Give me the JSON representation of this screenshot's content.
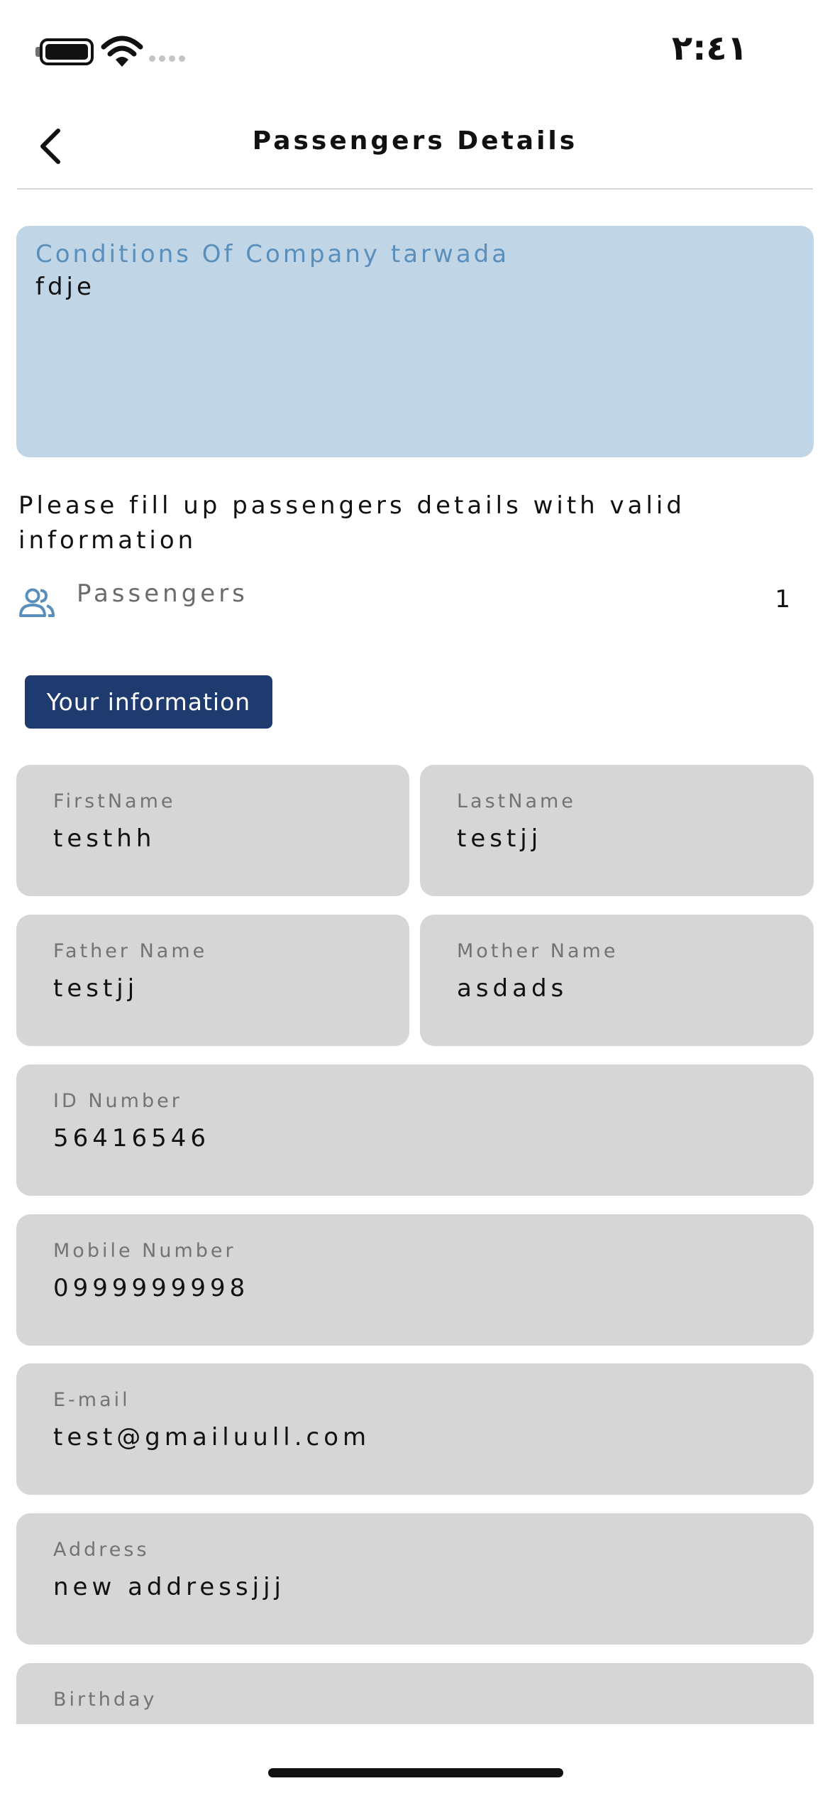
{
  "status_bar": {
    "time": "٢:٤١",
    "icons": [
      "battery-icon",
      "wifi-icon",
      "signal-icon"
    ]
  },
  "nav": {
    "title": "Passengers Details",
    "back_icon": "chevron-left-icon"
  },
  "conditions": {
    "title": "Conditions Of Company tarwada",
    "body": "fdje",
    "background": "#c0d6e7",
    "title_color": "#5a8fbc"
  },
  "instructions": "Please fill up passengers details with valid information",
  "passengers": {
    "icon": "people-icon",
    "label": "Passengers",
    "count": "1"
  },
  "tab": {
    "label": "Your information",
    "color": "#1f3a6e"
  },
  "form": {
    "first_name": {
      "label": "FirstName",
      "value": "testhh"
    },
    "last_name": {
      "label": "LastName",
      "value": "testjj"
    },
    "father_name": {
      "label": "Father Name",
      "value": "testjj"
    },
    "mother_name": {
      "label": "Mother Name",
      "value": "asdads"
    },
    "id_number": {
      "label": "ID Number",
      "value": "56416546"
    },
    "mobile": {
      "label": "Mobile Number",
      "value": "0999999998"
    },
    "email": {
      "label": "E-mail",
      "value": "test@gmailuull.com"
    },
    "address": {
      "label": "Address",
      "value": "new addressjjj"
    },
    "birthday": {
      "label": "Birthday"
    }
  }
}
